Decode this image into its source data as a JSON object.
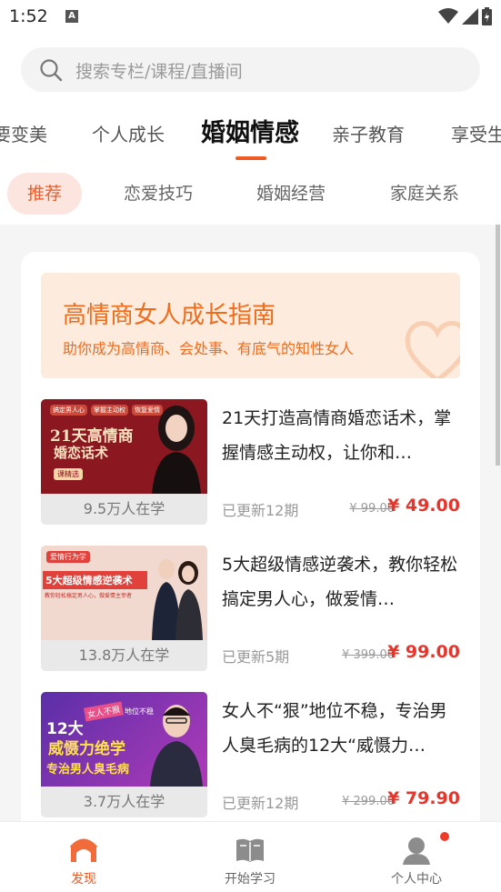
{
  "status_bar": {
    "time": "1:52",
    "notification_icon": "A"
  },
  "search": {
    "placeholder": "搜索专栏/课程/直播间"
  },
  "categories": [
    {
      "label": "要变美"
    },
    {
      "label": "个人成长"
    },
    {
      "label": "婚姻情感",
      "active": true
    },
    {
      "label": "亲子教育"
    },
    {
      "label": "享受生"
    }
  ],
  "subtabs": [
    {
      "label": "推荐",
      "active": true
    },
    {
      "label": "恋爱技巧"
    },
    {
      "label": "婚姻经营"
    },
    {
      "label": "家庭关系"
    }
  ],
  "banner": {
    "title": "高情商女人成长指南",
    "subtitle": "助你成为高情商、会处事、有底气的知性女人"
  },
  "courses": [
    {
      "title": "21天打造高情商婚恋话术，掌握情感主动权，让你和…",
      "learners": "9.5万人在学",
      "updates": "已更新12期",
      "old_price": "¥ 99.00",
      "price": "¥ 49.00",
      "thumb": {
        "tags": [
          "搞定男人心",
          "掌握主动权",
          "恢复爱情"
        ],
        "headline": "21天高情商",
        "headline2": "婚恋话术",
        "badge": "课精选",
        "bg": "#8b1720"
      }
    },
    {
      "title": "5大超级情感逆袭术，教你轻松搞定男人心，做爱情…",
      "learners": "13.8万人在学",
      "updates": "已更新5期",
      "old_price": "¥ 399.00",
      "price": "¥ 99.00",
      "thumb": {
        "tags": [
          "爱情行为学"
        ],
        "headline": "5大超级情感逆袭术",
        "headline2": "教你轻松搞定男人心，做爱情主宰者",
        "badge": "",
        "bg": "#f2d9d0"
      }
    },
    {
      "title": "女人不“狠”地位不稳，专治男人臭毛病的12大“威慑力…",
      "learners": "3.7万人在学",
      "updates": "已更新12期",
      "old_price": "¥ 299.00",
      "price": "¥ 79.90",
      "thumb": {
        "tags": [
          "女人不狠",
          "地位不稳"
        ],
        "headline": "12大",
        "headline2": "威慑力绝学",
        "badge": "专治男人臭毛病",
        "bg": "#8a2fb0"
      }
    }
  ],
  "bottom_nav": [
    {
      "label": "发现",
      "icon": "discover-icon",
      "active": true
    },
    {
      "label": "开始学习",
      "icon": "book-icon"
    },
    {
      "label": "个人中心",
      "icon": "user-icon"
    }
  ],
  "colors": {
    "accent": "#f05a24",
    "price": "#e8352b",
    "banner_bg": "#fdebdd"
  }
}
